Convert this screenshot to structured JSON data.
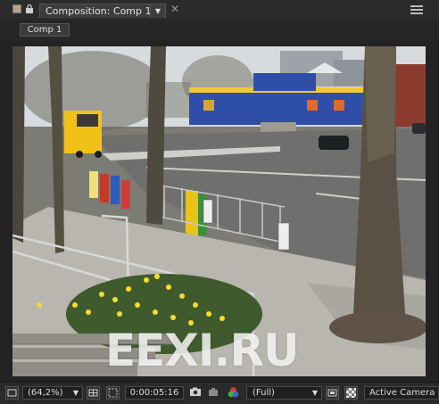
{
  "panel": {
    "tab_label": "Composition: Comp 1",
    "dropdown_glyph": "▼",
    "close_glyph": "✕"
  },
  "subbar": {
    "comp_button": "Comp 1"
  },
  "footer": {
    "magnification": "(64,2%)",
    "timecode": "0:00:05:16",
    "resolution": "(Full)",
    "view": "Active Camera"
  },
  "watermark": "EEXI.RU",
  "icons": [
    "color-swatch-icon",
    "lock-icon",
    "panel-menu-icon",
    "always-preview-icon",
    "grid-overlay-icon",
    "region-of-interest-icon",
    "snapshot-icon",
    "show-channel-icon",
    "toggle-pixel-aspect-icon",
    "transparency-grid-icon"
  ],
  "colors": {
    "panel_bg": "#232323",
    "accent_orange": "#e28b3a",
    "bus_yellow": "#f2c118",
    "building_blue": "#2e4ea8"
  }
}
